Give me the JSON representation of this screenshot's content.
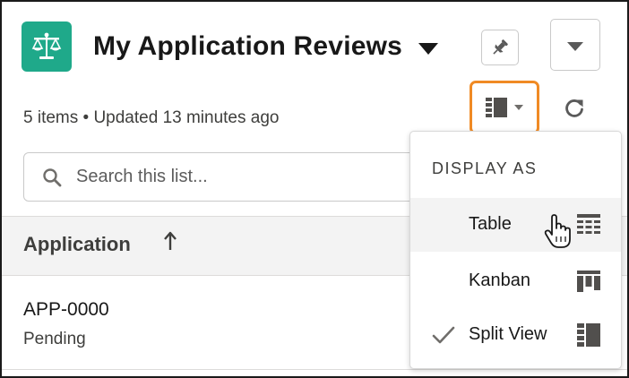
{
  "header": {
    "title": "My Application Reviews",
    "app_icon": "scales-icon",
    "accent_color": "#1fa98a"
  },
  "meta": {
    "summary": "5 items • Updated 13 minutes ago"
  },
  "search": {
    "placeholder": "Search this list..."
  },
  "table": {
    "columns": [
      {
        "label": "Application",
        "sort": "ascending"
      }
    ],
    "rows": [
      {
        "id": "APP-0000",
        "status": "Pending"
      }
    ]
  },
  "display_menu": {
    "header": "DISPLAY AS",
    "highlight_color": "#f08a24",
    "items": [
      {
        "label": "Table",
        "icon": "table-icon",
        "selected": false,
        "hovered": true
      },
      {
        "label": "Kanban",
        "icon": "kanban-icon",
        "selected": false,
        "hovered": false
      },
      {
        "label": "Split View",
        "icon": "split-view-icon",
        "selected": true,
        "hovered": false
      }
    ]
  }
}
